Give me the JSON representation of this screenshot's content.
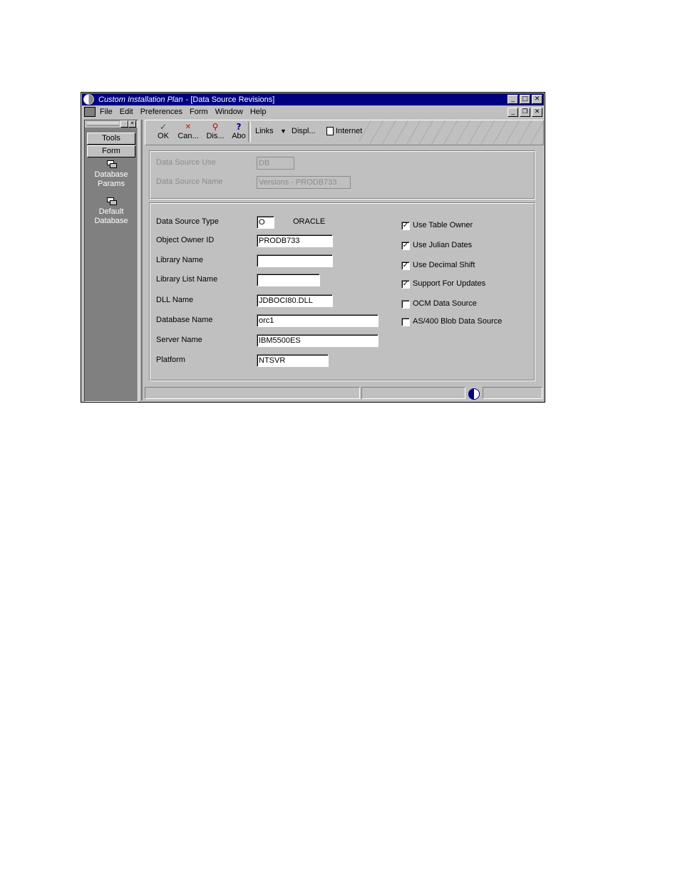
{
  "window": {
    "app_title": "Custom Installation Plan",
    "doc_title": " - [Data Source Revisions]",
    "min": "_",
    "max": "□",
    "close": "✕",
    "restore": "❐"
  },
  "menu": [
    "File",
    "Edit",
    "Preferences",
    "Form",
    "Window",
    "Help"
  ],
  "sidebar": {
    "buttons": [
      "Tools",
      "Form"
    ],
    "items": [
      {
        "line1": "Database",
        "line2": "Params"
      },
      {
        "line1": "Default",
        "line2": "Database"
      }
    ]
  },
  "toolbar": {
    "ok": {
      "glyph": "✓",
      "label": "OK"
    },
    "cancel": {
      "glyph": "✕",
      "label": "Can..."
    },
    "display": {
      "glyph": "⚲",
      "label": "Dis..."
    },
    "about": {
      "glyph": "?",
      "label": "Abo"
    },
    "links": "Links",
    "display_menu": "Displ...",
    "internet": "Internet"
  },
  "header_fields": {
    "data_source_use": {
      "label": "Data Source Use",
      "value": "DB"
    },
    "data_source_name": {
      "label": "Data Source Name",
      "value": "Versions - PRODB733"
    }
  },
  "form": {
    "data_source_type": {
      "label": "Data Source Type",
      "value": "O",
      "desc": "ORACLE"
    },
    "object_owner_id": {
      "label": "Object Owner ID",
      "value": "PRODB733"
    },
    "library_name": {
      "label": "Library Name",
      "value": ""
    },
    "library_list_name": {
      "label": "Library List Name",
      "value": ""
    },
    "dll_name": {
      "label": "DLL Name",
      "value": "JDBOCI80.DLL"
    },
    "database_name": {
      "label": "Database Name",
      "value": "orc1"
    },
    "server_name": {
      "label": "Server Name",
      "value": "IBM5500ES"
    },
    "platform": {
      "label": "Platform",
      "value": "NTSVR"
    }
  },
  "checkboxes": [
    {
      "label": "Use Table Owner",
      "checked": true
    },
    {
      "label": "Use Julian Dates",
      "checked": true
    },
    {
      "label": "Use Decimal Shift",
      "checked": true
    },
    {
      "label": "Support For Updates",
      "checked": true
    },
    {
      "label": "OCM Data Source",
      "checked": false
    },
    {
      "label": "AS/400 Blob Data Source",
      "checked": false
    }
  ],
  "check_glyph": "✓",
  "colors": {
    "titlebar": "#000080",
    "face": "#c0c0c0",
    "sidebar": "#808080"
  }
}
